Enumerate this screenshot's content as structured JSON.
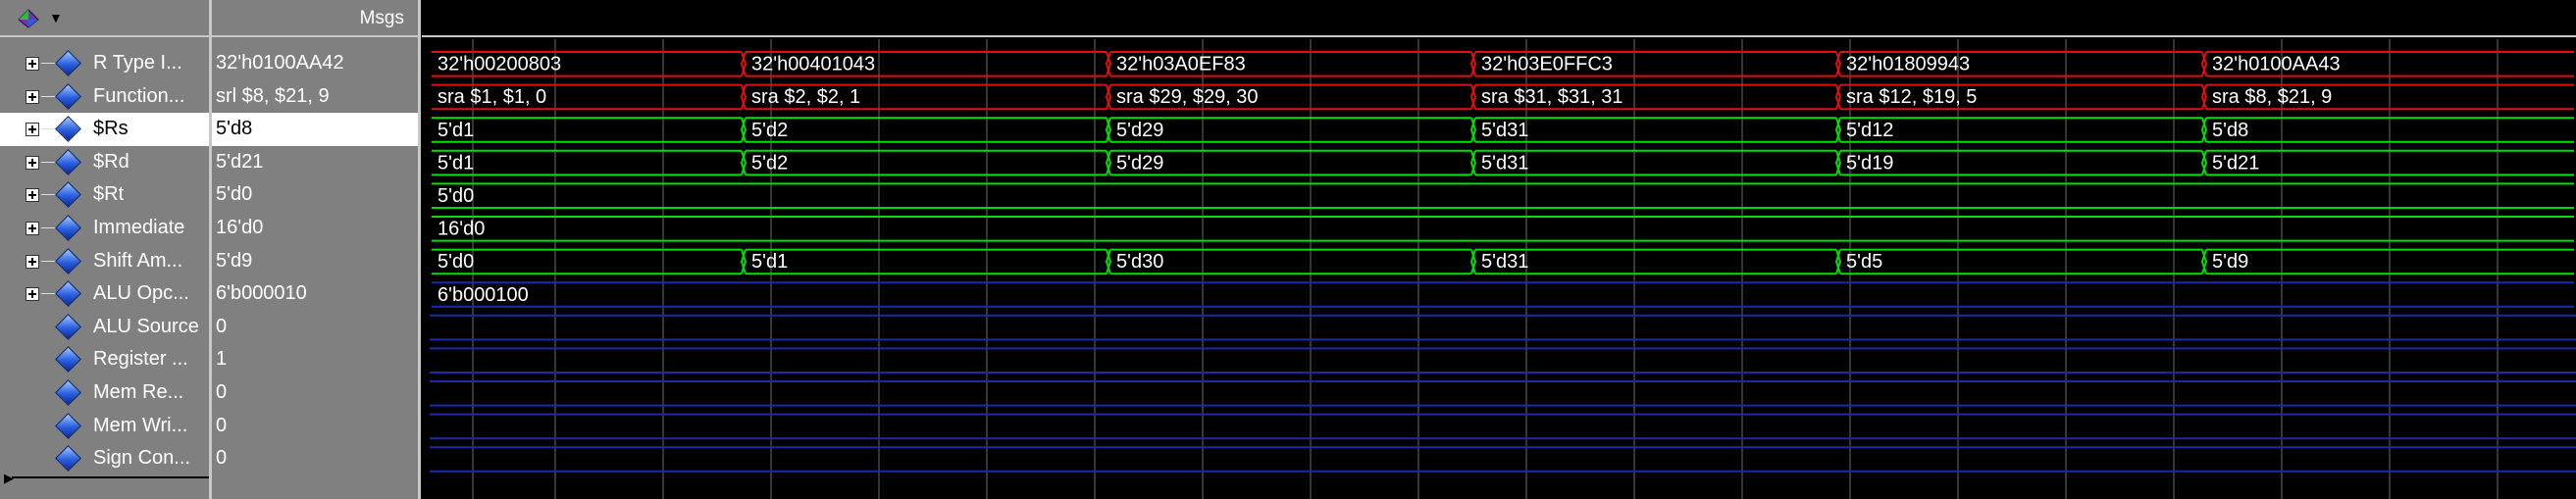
{
  "header": {
    "msgs_label": "Msgs"
  },
  "colors": {
    "bus_red": "#e01010",
    "bus_green": "#00e000",
    "bus_blue": "#1a2aa8",
    "grid": "#ffffff"
  },
  "signals": [
    {
      "name": "R Type I...",
      "value": "32'h0100AA42",
      "expandable": true,
      "color": "red",
      "segments": [
        "32'h00200803",
        "32'h00401043",
        "32'h03A0EF83",
        "32'h03E0FFC3",
        "32'h01809943",
        "32'h0100AA43"
      ]
    },
    {
      "name": "Function...",
      "value": "srl $8, $21, 9",
      "expandable": true,
      "color": "red",
      "segments": [
        "sra $1, $1, 0",
        "sra $2, $2, 1",
        "sra $29, $29, 30",
        "sra $31, $31, 31",
        "sra $12, $19, 5",
        "sra $8, $21, 9"
      ]
    },
    {
      "name": "$Rs",
      "value": "5'd8",
      "expandable": true,
      "color": "green",
      "selected": true,
      "segments": [
        "5'd1",
        "5'd2",
        "5'd29",
        "5'd31",
        "5'd12",
        "5'd8"
      ]
    },
    {
      "name": "$Rd",
      "value": "5'd21",
      "expandable": true,
      "color": "green",
      "segments": [
        "5'd1",
        "5'd2",
        "5'd29",
        "5'd31",
        "5'd19",
        "5'd21"
      ]
    },
    {
      "name": "$Rt",
      "value": "5'd0",
      "expandable": true,
      "color": "green",
      "segments": [
        "5'd0"
      ]
    },
    {
      "name": "Immediate",
      "value": "16'd0",
      "expandable": true,
      "color": "green",
      "segments": [
        "16'd0"
      ]
    },
    {
      "name": "Shift Am...",
      "value": "5'd9",
      "expandable": true,
      "color": "green",
      "segments": [
        "5'd0",
        "5'd1",
        "5'd30",
        "5'd31",
        "5'd5",
        "5'd9"
      ]
    },
    {
      "name": "ALU Opc...",
      "value": "6'b000010",
      "expandable": true,
      "color": "blue",
      "segments": [
        "6'b000100"
      ]
    },
    {
      "name": "ALU Source",
      "value": "0",
      "expandable": false,
      "color": "blue",
      "segments": []
    },
    {
      "name": "Register ...",
      "value": "1",
      "expandable": false,
      "color": "blue",
      "segments": []
    },
    {
      "name": "Mem Re...",
      "value": "0",
      "expandable": false,
      "color": "blue",
      "segments": []
    },
    {
      "name": "Mem Wri...",
      "value": "0",
      "expandable": false,
      "color": "blue",
      "segments": []
    },
    {
      "name": "Sign Con...",
      "value": "0",
      "expandable": false,
      "color": "blue",
      "segments": []
    }
  ]
}
